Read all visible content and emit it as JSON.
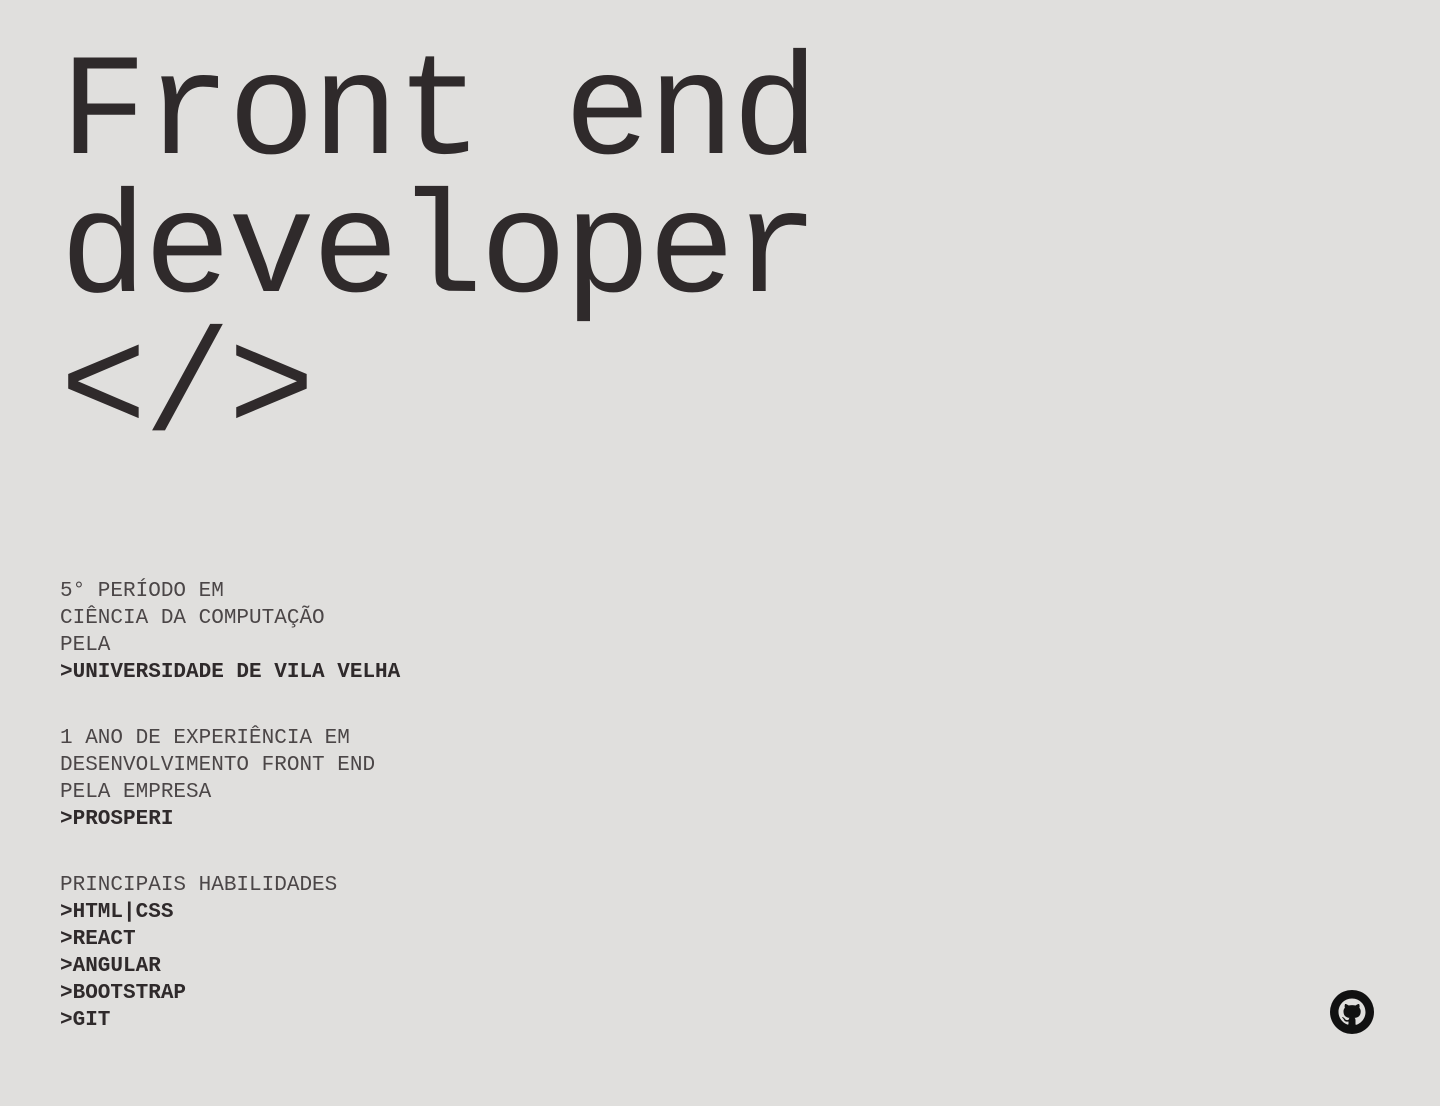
{
  "hero": {
    "line1": "Front end",
    "line2": "developer",
    "line3": "</>"
  },
  "education": {
    "lines": [
      "5° PERÍODO EM",
      "CIÊNCIA DA COMPUTAÇÃO",
      "PELA"
    ],
    "highlight": ">UNIVERSIDADE DE VILA VELHA"
  },
  "experience": {
    "lines": [
      "1 ANO DE EXPERIÊNCIA EM",
      "DESENVOLVIMENTO FRONT END",
      "PELA EMPRESA"
    ],
    "highlight": ">PROSPERI"
  },
  "skills": {
    "heading": "PRINCIPAIS HABILIDADES",
    "items": [
      ">HTML|CSS",
      ">REACT",
      ">ANGULAR",
      ">BOOTSTRAP",
      ">GIT"
    ]
  },
  "footer": {
    "github_icon": "github-icon"
  },
  "colors": {
    "background": "#e0dfdd",
    "text": "#2f2a2b",
    "muted_text": "#4b4647"
  }
}
